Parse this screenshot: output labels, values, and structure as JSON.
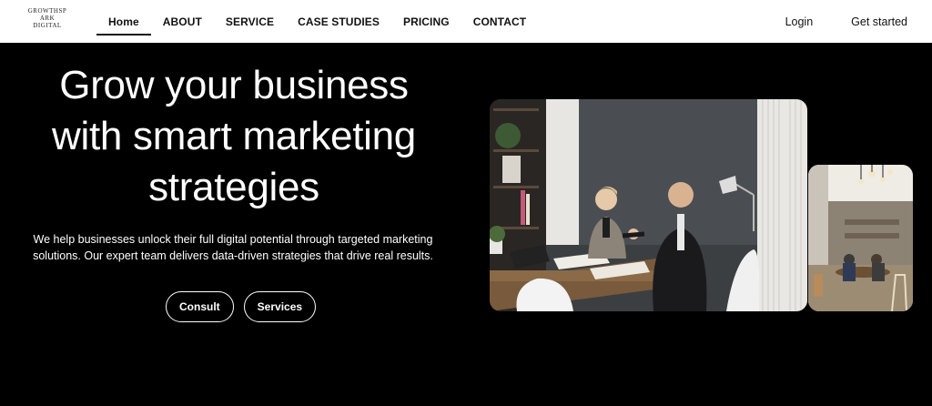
{
  "brand": {
    "logo_lines": [
      "GROWTHSP",
      "ARK",
      "DIGITAL"
    ]
  },
  "nav": {
    "items": [
      {
        "label": "Home",
        "active": true
      },
      {
        "label": "ABOUT"
      },
      {
        "label": "SERVICE"
      },
      {
        "label": "CASE STUDIES"
      },
      {
        "label": "PRICING"
      },
      {
        "label": "CONTACT"
      }
    ]
  },
  "header_actions": {
    "login": "Login",
    "get_started": "Get started"
  },
  "hero": {
    "title_lines": [
      "Grow your business",
      "with smart marketing",
      "strategies"
    ],
    "subtitle_lines": [
      "We help businesses unlock their full digital potential through targeted marketing",
      "solutions. Our expert team delivers data-driven strategies that drive real results."
    ],
    "buttons": {
      "consult": "Consult",
      "services": "Services"
    }
  },
  "images": {
    "main": "office-meeting-handshake-photo",
    "side": "cafe-interior-photo"
  },
  "colors": {
    "background": "#000000",
    "header_bg": "#ffffff",
    "text_light": "#ffffff",
    "text_dark": "#111111"
  }
}
